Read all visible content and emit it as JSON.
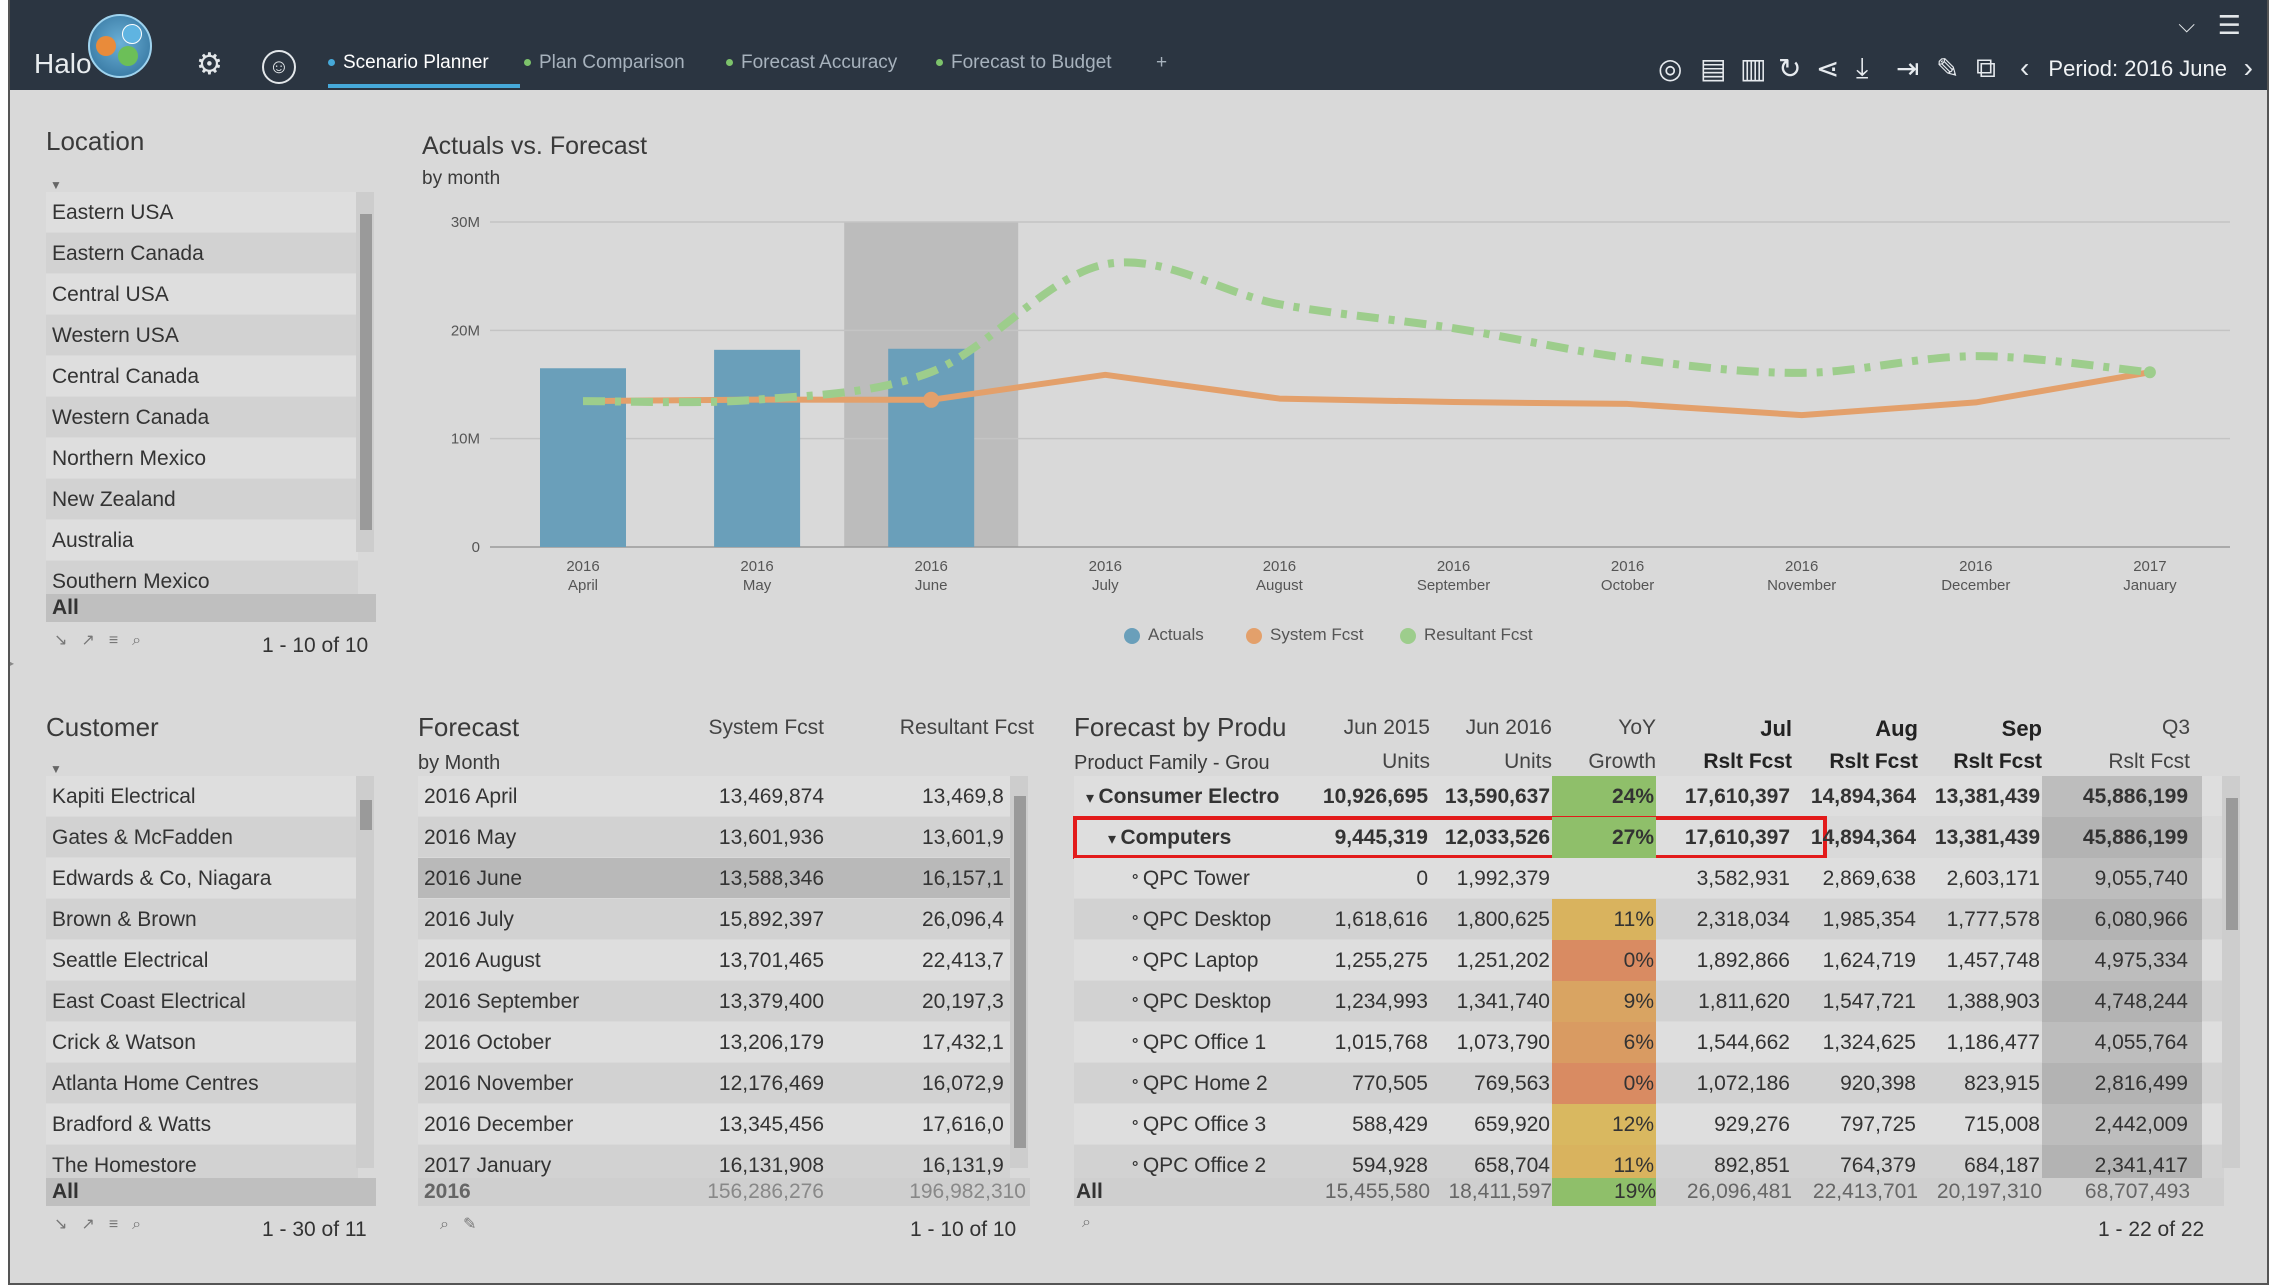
{
  "app": {
    "logo": "Halo",
    "tabs": [
      {
        "label": "Scenario Planner",
        "dot": "#46a9d9",
        "active": true
      },
      {
        "label": "Plan Comparison",
        "dot": "#7dc36b",
        "active": false
      },
      {
        "label": "Forecast Accuracy",
        "dot": "#7dc36b",
        "active": false
      },
      {
        "label": "Forecast to Budget",
        "dot": "#7dc36b",
        "active": false
      }
    ],
    "add_tab": "+",
    "period": "Period: 2016 June"
  },
  "location": {
    "title": "Location",
    "items": [
      "Eastern USA",
      "Eastern Canada",
      "Central USA",
      "Western USA",
      "Central Canada",
      "Western Canada",
      "Northern Mexico",
      "New Zealand",
      "Australia",
      "Southern Mexico"
    ],
    "all": "All",
    "count": "1 - 10 of 10"
  },
  "customer": {
    "title": "Customer",
    "items": [
      "Kapiti Electrical",
      "Gates & McFadden",
      "Edwards & Co, Niagara",
      "Brown & Brown",
      "Seattle Electrical",
      "East Coast Electrical",
      "Crick & Watson",
      "Atlanta Home Centres",
      "Bradford & Watts",
      "The Homestore"
    ],
    "all": "All",
    "count": "1 - 30 of 11"
  },
  "chart": {
    "title": "Actuals vs. Forecast",
    "subtitle": "by month"
  },
  "chart_data": {
    "type": "bar",
    "title": "Actuals vs. Forecast",
    "subtitle": "by month",
    "categories": [
      "2016 April",
      "2016 May",
      "2016 June",
      "2016 July",
      "2016 August",
      "2016 September",
      "2016 October",
      "2016 November",
      "2016 December",
      "2017 January"
    ],
    "cat_year": [
      "2016",
      "2016",
      "2016",
      "2016",
      "2016",
      "2016",
      "2016",
      "2016",
      "2016",
      "2017"
    ],
    "cat_month": [
      "April",
      "May",
      "June",
      "July",
      "August",
      "September",
      "October",
      "November",
      "December",
      "January"
    ],
    "yticks": [
      "0",
      "10M",
      "20M",
      "30M"
    ],
    "ylim": [
      0,
      30000000
    ],
    "highlight_category": "2016 June",
    "series": [
      {
        "name": "Actuals",
        "kind": "bar",
        "color": "#6a9fba",
        "values": [
          16500000,
          18200000,
          18300000,
          null,
          null,
          null,
          null,
          null,
          null,
          null
        ]
      },
      {
        "name": "System Fcst",
        "kind": "line",
        "color": "#e3a06b",
        "values": [
          13469874,
          13601936,
          13588346,
          15892397,
          13701465,
          13379400,
          13206179,
          12176469,
          13345456,
          16131908
        ]
      },
      {
        "name": "Resultant Fcst",
        "kind": "dashed-line",
        "color": "#9dcd8c",
        "values": [
          13469874,
          13601936,
          16157100,
          26096400,
          22413700,
          20197300,
          17432100,
          16072900,
          17616000,
          16131900
        ]
      }
    ],
    "legend": "bottom"
  },
  "forecast": {
    "title": "Forecast",
    "subtitle": "by Month",
    "col_system": "System Fcst",
    "col_result": "Resultant Fcst",
    "rows": [
      {
        "m": "2016 April",
        "s": "13,469,874",
        "r": "13,469,8"
      },
      {
        "m": "2016 May",
        "s": "13,601,936",
        "r": "13,601,9"
      },
      {
        "m": "2016 June",
        "s": "13,588,346",
        "r": "16,157,1"
      },
      {
        "m": "2016 July",
        "s": "15,892,397",
        "r": "26,096,4"
      },
      {
        "m": "2016 August",
        "s": "13,701,465",
        "r": "22,413,7"
      },
      {
        "m": "2016 September",
        "s": "13,379,400",
        "r": "20,197,3"
      },
      {
        "m": "2016 October",
        "s": "13,206,179",
        "r": "17,432,1"
      },
      {
        "m": "2016 November",
        "s": "12,176,469",
        "r": "16,072,9"
      },
      {
        "m": "2016 December",
        "s": "13,345,456",
        "r": "17,616,0"
      },
      {
        "m": "2017 January",
        "s": "16,131,908",
        "r": "16,131,9"
      }
    ],
    "total": {
      "m": "2016",
      "s": "156,286,276",
      "r": "196,982,310"
    },
    "count": "1 - 10 of 10"
  },
  "product": {
    "title": "Forecast by Produ",
    "subtitle": "Product Family - Grou",
    "headers": [
      {
        "top": "Jun 2015",
        "bot": "Units",
        "bold": false
      },
      {
        "top": "Jun 2016",
        "bot": "Units",
        "bold": false
      },
      {
        "top": "YoY",
        "bot": "Growth",
        "bold": false
      },
      {
        "top": "Jul",
        "bot": "Rslt Fcst",
        "bold": true
      },
      {
        "top": "Aug",
        "bot": "Rslt Fcst",
        "bold": true
      },
      {
        "top": "Sep",
        "bot": "Rslt Fcst",
        "bold": true
      },
      {
        "top": "Q3",
        "bot": "Rslt Fcst",
        "bold": false
      }
    ],
    "rows": [
      {
        "name": "Consumer Electro",
        "lvl": 0,
        "bold": true,
        "v": [
          "10,926,695",
          "13,590,637",
          "24%",
          "17,610,397",
          "14,894,364",
          "13,381,439",
          "45,886,199"
        ],
        "gc": "#8fbf6a"
      },
      {
        "name": "Computers",
        "lvl": 1,
        "bold": true,
        "v": [
          "9,445,319",
          "12,033,526",
          "27%",
          "17,610,397",
          "14,894,364",
          "13,381,439",
          "45,886,199"
        ],
        "gc": "#8fbf6a"
      },
      {
        "name": "QPC Tower",
        "lvl": 2,
        "bold": false,
        "v": [
          "0",
          "1,992,379",
          "",
          "3,582,931",
          "2,869,638",
          "2,603,171",
          "9,055,740"
        ],
        "gc": ""
      },
      {
        "name": "QPC Desktop",
        "lvl": 2,
        "bold": false,
        "v": [
          "1,618,616",
          "1,800,625",
          "11%",
          "2,318,034",
          "1,985,354",
          "1,777,578",
          "6,080,966"
        ],
        "gc": "#d9b35e"
      },
      {
        "name": "QPC Laptop",
        "lvl": 2,
        "bold": false,
        "v": [
          "1,255,275",
          "1,251,202",
          "0%",
          "1,892,866",
          "1,624,719",
          "1,457,748",
          "4,975,334"
        ],
        "gc": "#d98b62"
      },
      {
        "name": "QPC Desktop",
        "lvl": 2,
        "bold": false,
        "v": [
          "1,234,993",
          "1,341,740",
          "9%",
          "1,811,620",
          "1,547,721",
          "1,388,903",
          "4,748,244"
        ],
        "gc": "#d9a462"
      },
      {
        "name": "QPC Office 1",
        "lvl": 2,
        "bold": false,
        "v": [
          "1,015,768",
          "1,073,790",
          "6%",
          "1,544,662",
          "1,324,625",
          "1,186,477",
          "4,055,764"
        ],
        "gc": "#d99b62"
      },
      {
        "name": "QPC Home 2",
        "lvl": 2,
        "bold": false,
        "v": [
          "770,505",
          "769,563",
          "0%",
          "1,072,186",
          "920,398",
          "823,915",
          "2,816,499"
        ],
        "gc": "#d98b62"
      },
      {
        "name": "QPC Office 3",
        "lvl": 2,
        "bold": false,
        "v": [
          "588,429",
          "659,920",
          "12%",
          "929,276",
          "797,725",
          "715,008",
          "2,442,009"
        ],
        "gc": "#d9b860"
      },
      {
        "name": "QPC Office 2",
        "lvl": 2,
        "bold": false,
        "v": [
          "594,928",
          "658,704",
          "11%",
          "892,851",
          "764,379",
          "684,187",
          "2,341,417"
        ],
        "gc": "#d9b35e"
      }
    ],
    "total": {
      "name": "All",
      "v": [
        "15,455,580",
        "18,411,597",
        "19%",
        "26,096,481",
        "22,413,701",
        "20,197,310",
        "68,707,493"
      ],
      "gc": "#8fbf6a"
    },
    "count": "1 - 22 of 22"
  }
}
